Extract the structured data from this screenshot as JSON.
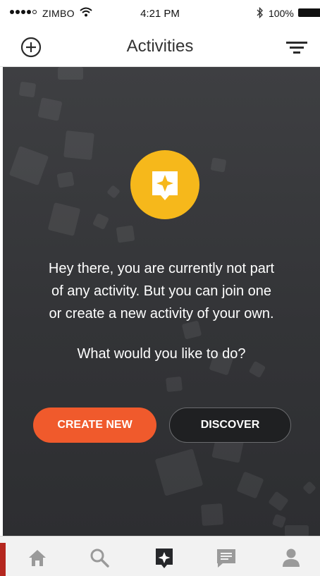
{
  "status_bar": {
    "carrier": "ZIMBO",
    "time": "4:21 PM",
    "battery": "100%",
    "icons": [
      "signal-dots",
      "wifi-icon",
      "bluetooth-icon",
      "battery-icon"
    ]
  },
  "header": {
    "title": "Activities",
    "left_icon": "add-circle-icon",
    "right_icon": "filter-icon"
  },
  "empty_state": {
    "icon": "activity-star-icon",
    "message_lines": [
      "Hey there, you are currently not part",
      "of any activity. But you can join one",
      "or create a new activity of your own."
    ],
    "question": "What would you like to do?"
  },
  "actions": {
    "create_label": "CREATE NEW",
    "discover_label": "DISCOVER"
  },
  "tab_bar": {
    "tabs": [
      {
        "icon": "home-icon",
        "active": false
      },
      {
        "icon": "search-icon",
        "active": false
      },
      {
        "icon": "activity-star-icon",
        "active": true
      },
      {
        "icon": "chat-icon",
        "active": false
      },
      {
        "icon": "profile-icon",
        "active": false
      }
    ]
  },
  "colors": {
    "accent_yellow": "#f6b81b",
    "create_orange": "#f05a2c",
    "dark_background": "#333437",
    "active_tab": "#26272a",
    "inactive_tab": "#9a9a9a"
  }
}
